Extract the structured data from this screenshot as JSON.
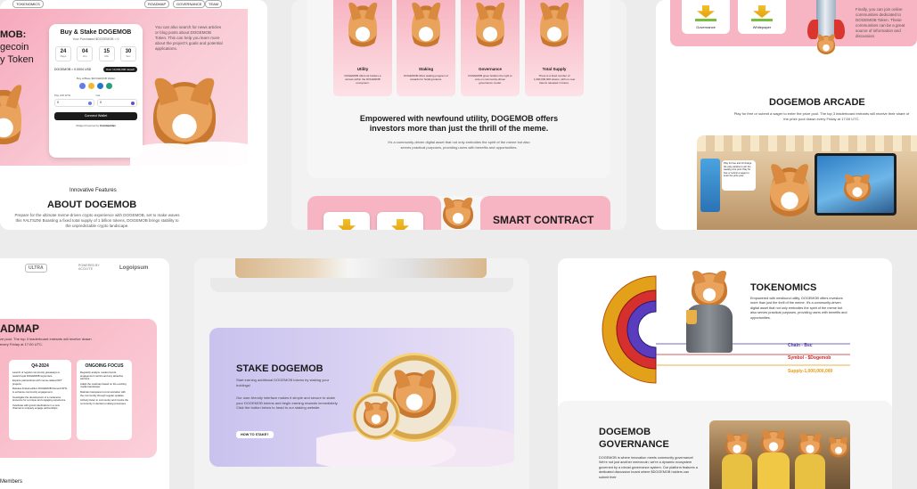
{
  "p1": {
    "nav": [
      "TOKENOMICS",
      "ROADMAP",
      "GOVERNANCE",
      "TEAM"
    ],
    "hero_left": [
      "MOB:",
      "gecoin",
      "y Token"
    ],
    "widget": {
      "title": "Buy & Stake DOGEMOB",
      "subtitle": "Your Purchased $DOGEMOB = 0",
      "countdown": [
        {
          "value": "24",
          "unit": "Days"
        },
        {
          "value": "04",
          "unit": "Hrs"
        },
        {
          "value": "15",
          "unit": "Min"
        },
        {
          "value": "30",
          "unit": "Sec"
        }
      ],
      "price_text": "DOGEMOB = 0.0004 USD",
      "price_badge": "Over 10,000,000 raised!",
      "buy_with": "Buy w/Base $DOGEMOB Wallet",
      "pay_label": "Pay with ETH",
      "get_label": "Get",
      "pay_value": "0",
      "get_value": "0",
      "connect": "Connect Wallet",
      "powered": "Widget Powered by",
      "powered_brand": "Coinmerider"
    },
    "right_text": "You can also search for news articles or blog posts about DOGEMOB Token. This can help you learn more about the project's goals and potential applications.",
    "innovative": "Innovative Features",
    "about_title": "ABOUT DOGEMOB",
    "about_text": "Prepare for the ultimate meme-driven crypto experience with DOGEMOB, set to make waves this #ALTSZN! Boasting a fixed total supply of 1 billion tokens, DOGEMOB brings stability to the unpredictable crypto landscape."
  },
  "p2": {
    "cards": [
      {
        "title": "Utility",
        "text": "DOGEMOB offers its holders a access within the DOGEMOB ecosystem."
      },
      {
        "title": "Staking",
        "text": "DOGEMOB offers staking program of rewards for holding tokens."
      },
      {
        "title": "Governance",
        "text": "DOGEMOB gives holders the right to vote on community-driven governance model."
      },
      {
        "title": "Total Supply",
        "text": "There is a fixed number of 1,000,000,000 tokens, with no new tokens released in future."
      }
    ],
    "headline": "Empowered with newfound utility, DOGEMOB offers investors more than just the thrill of the meme.",
    "subline": "It's a community-driven digital asset that not only embodies the spirit of the meme but also serves practical purposes, providing users with benefits and opportunities.",
    "smart_contract": "SMART CONTRACT"
  },
  "p3": {
    "labels": [
      "Governance",
      "Whitepaper"
    ],
    "intro": "Finally, you can join online communities dedicated to DOGEMOB Token. These communities can be a great source of information and discussion.",
    "arcade_title": "DOGEMOB ARCADE",
    "arcade_text": "Play for free or submit a wager to enter the prize pool. The top 3 leaderboard entrants will receive their share of the prize pool drawn every Friday at 17:00 UTC.",
    "bubble": "Play for free and 10 charge the play-window to win the weekly prize pool. Play for free or submit a wager to enter the prize pool."
  },
  "p4": {
    "logos": [
      "ULTRA",
      "POWERED BY ACOLYTE",
      "Logoipsum"
    ],
    "roadmap_title": "ADMAP",
    "roadmap_text": "ze pool. The top 3 leaderboard entrants will receive drawn every Friday at 17:00 UTC.",
    "q4": {
      "title": "Q4-2024",
      "items": [
        "Launch of regular community giveaways to reward loyal DOGEMOB supporters.",
        "Explore partnerships with meme-related NFT projects.",
        "Release limited-edition DOGEMOB themed NFTs to enhance community engagement.",
        "Investigate the development of a metaverse presence for a unique and engaging experience.",
        "Celebrate with grand celebrations in a new channel to uniquely engage partnerships."
      ]
    },
    "ongoing": {
      "title": "ONGOING FOCUS",
      "items": [
        "Regularly analyze market trends, engagement metrics and any attractive partners.",
        "Adapt the roadmap based on the evolving market landscape.",
        "Maintain transparent communication with the community through regular updates.",
        "Actively listen to community and involve the community in decision-making processes."
      ]
    },
    "members": "Members"
  },
  "p5": {
    "stake_title": "STAKE DOGEMOB",
    "stake_text1": "Start earning additional DOGEMOB tokens by staking your holdings!",
    "stake_text2": "Our user-friendly interface makes it simple and secure to stake your DOGEMOB tokens and begin earning rewards immediately. Click the button below to head to our staking website.",
    "stake_button": "HOW TO STAKE?"
  },
  "p6": {
    "tokenomics_title": "TOKENOMICS",
    "tokenomics_text": "Empowered with newfound utility, DOGEMOB offers investors more than just the thrill of the meme. It's a community-driven digital asset that not only embodies the spirit of the meme but also serves practical purposes, providing users with benefits and opportunities.",
    "legend": [
      {
        "text": "Chain - Bsc",
        "color": "#4a3aa8"
      },
      {
        "text": "Symbol - $Dogemob",
        "color": "#c8262a"
      },
      {
        "text": "Supply-1,000,000,000",
        "color": "#e39a12"
      }
    ],
    "governance_title": [
      "DOGEMOB",
      "GOVERNANCE"
    ],
    "governance_text": "DOGEMOB is where innovation meets community governance! We're not just another memecoin; we're a dynamic ecosystem governed by a robust governance system. Our platform features a dedicated discussion board where $DOGEMOB holders can submit their"
  },
  "colors": {
    "pink": "#f7b4c2",
    "pink_light": "#fde1e6",
    "lavender": "#cfc7ef",
    "dark": "#1b1b1b"
  },
  "icons": [
    "download-icon",
    "shiba-icon",
    "coin-icon",
    "rocket-icon",
    "eth-icon",
    "usdt-icon",
    "bnb-icon"
  ]
}
